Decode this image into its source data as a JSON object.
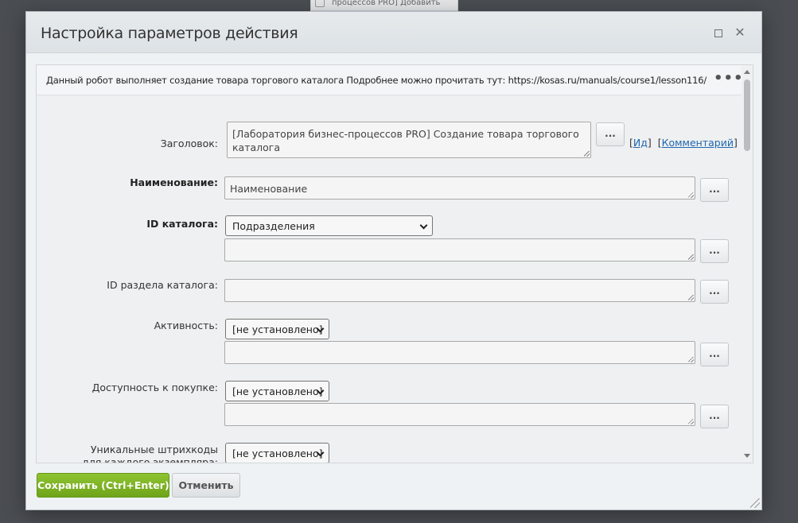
{
  "background": {
    "strip_text": "процессов PRO] Добавить"
  },
  "dialog": {
    "title": "Настройка параметров действия",
    "info_text": "Данный робот выполняет создание товара торгового каталога Подробнее можно прочитать тут: https://kosas.ru/manuals/course1/lesson116/",
    "more_button": "•••",
    "dot_button_label": "...",
    "links": {
      "open_bracket": "[",
      "id_label": "Ид",
      "mid_bracket": "]  [",
      "comment_label": "Комментарий",
      "close_bracket": "]"
    },
    "fields": {
      "title_label": "Заголовок:",
      "title_value": "[Лаборатория бизнес-процессов PRO] Создание товара торгового каталога",
      "name_label": "Наименование:",
      "name_value": "Наименование",
      "catalog_id_label": "ID каталога:",
      "catalog_id_selected": "Подразделения",
      "catalog_id_value": "",
      "section_id_label": "ID раздела каталога:",
      "section_id_value": "",
      "active_label": "Активность:",
      "active_selected": "[не установлено]",
      "active_value": "",
      "purchase_label": "Доступность к покупке:",
      "purchase_selected": "[не установлено]",
      "purchase_value": "",
      "barcode_label": "Уникальные штрихкоды для каждого экземпляра:",
      "barcode_selected": "[не установлено]"
    },
    "buttons": {
      "save": "Сохранить (Ctrl+Enter)",
      "cancel": "Отменить"
    }
  }
}
